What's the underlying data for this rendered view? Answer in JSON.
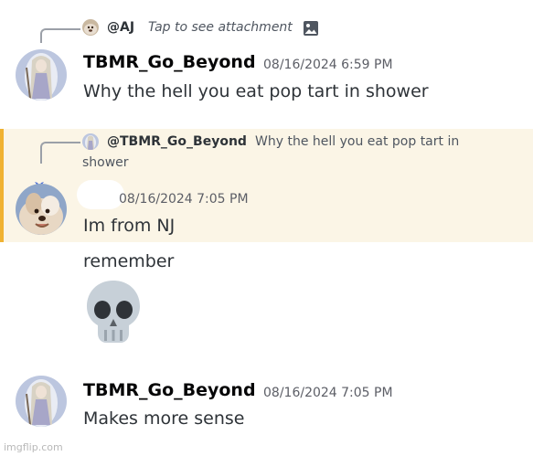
{
  "messages": [
    {
      "reply": {
        "name": "@AJ",
        "text": "Tap to see attachment",
        "icon": "image-icon"
      },
      "author": "TBMR_Go_Beyond",
      "timestamp": "08/16/2024 6:59 PM",
      "lines": [
        "Why the hell you eat pop tart in shower"
      ]
    },
    {
      "reply": {
        "name": "@TBMR_Go_Beyond",
        "text_line1": "Why the hell you eat pop tart in",
        "text_line2": "shower"
      },
      "author": "",
      "timestamp": "08/16/2024 7:05 PM",
      "lines": [
        "Im from NJ",
        "remember"
      ],
      "emoji": "skull-emoji",
      "highlighted": true
    },
    {
      "author": "TBMR_Go_Beyond",
      "timestamp": "08/16/2024 7:05 PM",
      "lines": [
        "Makes more sense"
      ]
    }
  ],
  "watermark": "imgflip.com",
  "colors": {
    "mention_highlight": "#fbf5e6",
    "mention_bar": "#f0b232",
    "text": "#2e3338",
    "muted": "#5c5e66"
  }
}
